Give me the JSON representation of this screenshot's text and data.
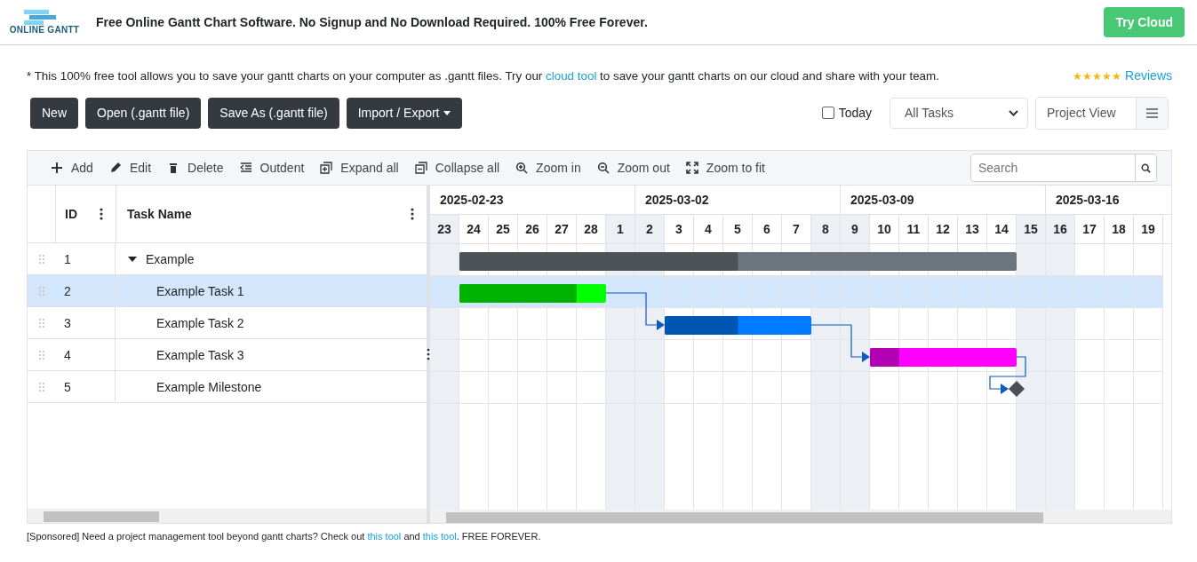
{
  "header": {
    "logo_text": "ONLINE GANTT",
    "tagline": "Free Online Gantt Chart Software. No Signup and No Download Required. 100% Free Forever.",
    "cta": "Try Cloud"
  },
  "notice": {
    "before": "* This 100% free tool allows you to save your gantt charts on your computer as .gantt files. Try our ",
    "link": "cloud tool",
    "after": " to save your gantt charts on our cloud and share with your team."
  },
  "reviews": {
    "stars": 5,
    "label": "Reviews"
  },
  "file_buttons": [
    {
      "label": "New",
      "kind": "plain"
    },
    {
      "label": "Open (.gantt file)",
      "kind": "plain"
    },
    {
      "label": "Save As (.gantt file)",
      "kind": "plain"
    },
    {
      "label": "Import / Export",
      "kind": "dropdown"
    }
  ],
  "today": {
    "label": "Today",
    "checked": false
  },
  "filter": {
    "value": "All Tasks"
  },
  "view": {
    "value": "Project View"
  },
  "toolbar": [
    "Add",
    "Edit",
    "Delete",
    "Outdent",
    "Expand all",
    "Collapse all",
    "Zoom in",
    "Zoom out",
    "Zoom to fit"
  ],
  "search": {
    "placeholder": "Search"
  },
  "grid": {
    "columns": [
      "ID",
      "Task Name"
    ],
    "tasks": [
      {
        "id": "1",
        "name": "Example",
        "kind": "summary",
        "expanded": true,
        "selected": false,
        "level": 0.5,
        "color": "#6c757d",
        "children": [
          {
            "id": "2",
            "name": "Example Task 1",
            "kind": "task",
            "selected": true,
            "level": 0.8,
            "color": "#00ff00",
            "linked_from_previous": false
          },
          {
            "id": "3",
            "name": "Example Task 2",
            "kind": "task",
            "selected": false,
            "level": 0.5,
            "color": "#007bff",
            "linked_from_previous": true
          },
          {
            "id": "4",
            "name": "Example Task 3",
            "kind": "task",
            "selected": false,
            "level": 0.2,
            "color": "#ff00ff",
            "linked_from_previous": true
          },
          {
            "id": "5",
            "name": "Example Milestone",
            "kind": "milestone",
            "selected": false,
            "color": "#495057",
            "linked_from_previous": true
          }
        ]
      }
    ]
  },
  "timeline": {
    "weeks": [
      "2025-02-23",
      "2025-03-02",
      "2025-03-09",
      "2025-03-16"
    ],
    "days": [
      {
        "label": "23",
        "weekend": true
      },
      {
        "label": "24",
        "weekend": false
      },
      {
        "label": "25",
        "weekend": false
      },
      {
        "label": "26",
        "weekend": false
      },
      {
        "label": "27",
        "weekend": false
      },
      {
        "label": "28",
        "weekend": false
      },
      {
        "label": "1",
        "weekend": true
      },
      {
        "label": "2",
        "weekend": true
      },
      {
        "label": "3",
        "weekend": false
      },
      {
        "label": "4",
        "weekend": false
      },
      {
        "label": "5",
        "weekend": false
      },
      {
        "label": "6",
        "weekend": false
      },
      {
        "label": "7",
        "weekend": false
      },
      {
        "label": "8",
        "weekend": true
      },
      {
        "label": "9",
        "weekend": true
      },
      {
        "label": "10",
        "weekend": false
      },
      {
        "label": "11",
        "weekend": false
      },
      {
        "label": "12",
        "weekend": false
      },
      {
        "label": "13",
        "weekend": false
      },
      {
        "label": "14",
        "weekend": false
      },
      {
        "label": "15",
        "weekend": true
      },
      {
        "label": "16",
        "weekend": true
      },
      {
        "label": "17",
        "weekend": false
      },
      {
        "label": "18",
        "weekend": false
      },
      {
        "label": "19",
        "weekend": false
      }
    ]
  },
  "footer": [
    {
      "kind": "text",
      "text": "[Sponsored] Need a project management tool beyond gantt charts? Check out "
    },
    {
      "kind": "link",
      "text": "this tool"
    },
    {
      "kind": "text",
      "text": " and "
    },
    {
      "kind": "link",
      "text": "this tool"
    },
    {
      "kind": "text",
      "text": ". FREE FOREVER."
    }
  ]
}
